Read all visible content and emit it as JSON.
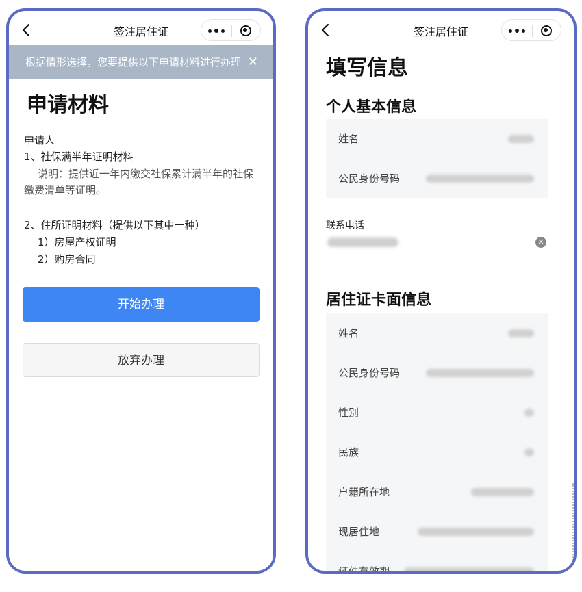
{
  "left_screen": {
    "window_title": "签注居住证",
    "banner_text": "根据情形选择，您要提供以下申请材料进行办理",
    "heading": "申请材料",
    "applicant_label": "申请人",
    "item1_title": "1、社保满半年证明材料",
    "item1_note_line1": "说明：提供近一年内缴交社保累计满半年的社保",
    "item1_note_line2": "缴费清单等证明。",
    "item2_title": "2、住所证明材料（提供以下其中一种）",
    "item2_option1": "1）房屋产权证明",
    "item2_option2": "2）购房合同",
    "start_button": "开始办理",
    "abandon_button": "放弃办理"
  },
  "right_screen": {
    "window_title": "签注居住证",
    "heading": "填写信息",
    "section_personal": "个人基本信息",
    "personal_fields": [
      {
        "label": "姓名"
      },
      {
        "label": "公民身份号码"
      }
    ],
    "contact_label": "联系电话",
    "section_card": "居住证卡面信息",
    "card_fields": [
      {
        "label": "姓名"
      },
      {
        "label": "公民身份号码"
      },
      {
        "label": "性别"
      },
      {
        "label": "民族"
      },
      {
        "label": "户籍所在地"
      },
      {
        "label": "现居住地"
      },
      {
        "label": "证件有效期"
      }
    ]
  },
  "icons": {
    "back": "chevron-left-icon",
    "more": "more-dots-icon",
    "close_miniprogram": "target-circle-icon",
    "banner_close": "close-icon",
    "clear_input": "clear-circle-icon"
  },
  "colors": {
    "frame": "#5b6bc4",
    "primary_button": "#3d86f3",
    "banner_bg": "#aab6c5",
    "panel_bg": "#f5f6f7"
  }
}
